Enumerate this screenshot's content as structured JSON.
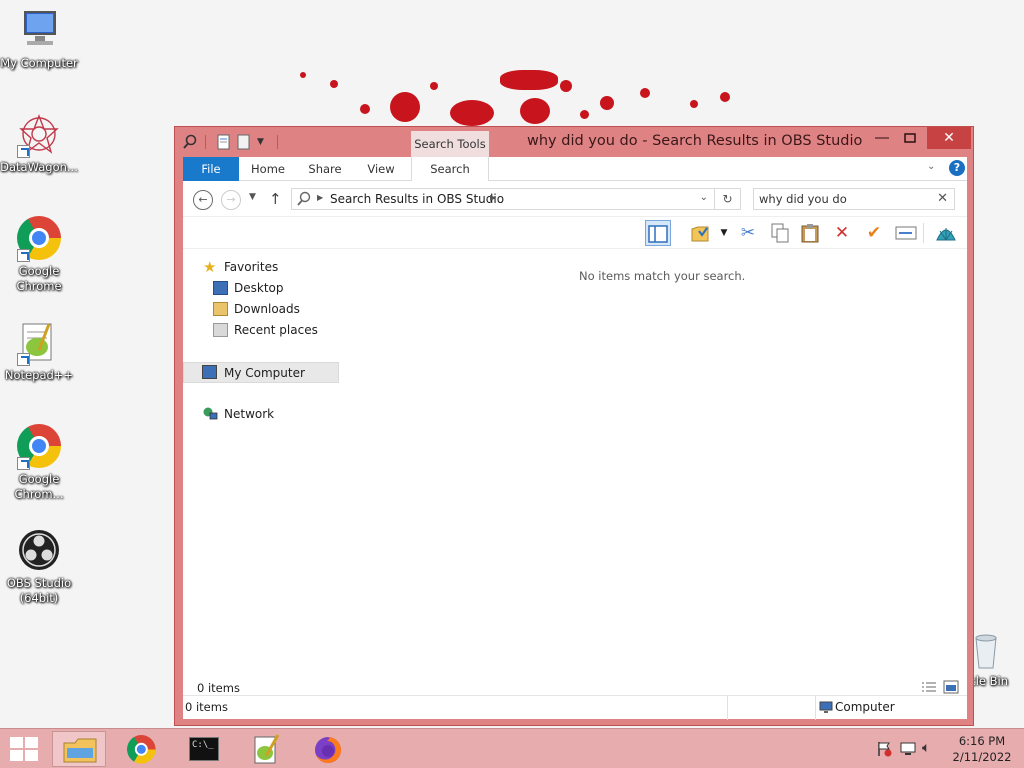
{
  "desktop": {
    "icons": [
      {
        "label": "My Computer"
      },
      {
        "label": "DataWagon..."
      },
      {
        "label": "Google Chrome"
      },
      {
        "label": "Notepad++"
      },
      {
        "label": "Google Chrom..."
      },
      {
        "label": "OBS Studio (64bit)"
      },
      {
        "label": "cle Bin"
      }
    ]
  },
  "window": {
    "title": "why did you do - Search Results in OBS Studio",
    "context_tab": "Search Tools",
    "ribbon_tabs": [
      "File",
      "Home",
      "Share",
      "View",
      "Search"
    ],
    "address": {
      "path": "Search Results in OBS Studio"
    },
    "search": {
      "value": "why did you do"
    },
    "empty_message": "No items match your search.",
    "items_count": "0 items",
    "nav": {
      "favorites": "Favorites",
      "desktop": "Desktop",
      "downloads": "Downloads",
      "recent": "Recent places",
      "computer": "My Computer",
      "network": "Network"
    },
    "status": {
      "left": "0 items",
      "right": "Computer"
    }
  },
  "taskbar": {
    "time": "6:16 PM",
    "date": "2/11/2022"
  },
  "colors": {
    "accent": "#1979ca",
    "window_frame": "#df8284",
    "close_button": "#c74343",
    "taskbar": "#e7acae"
  }
}
